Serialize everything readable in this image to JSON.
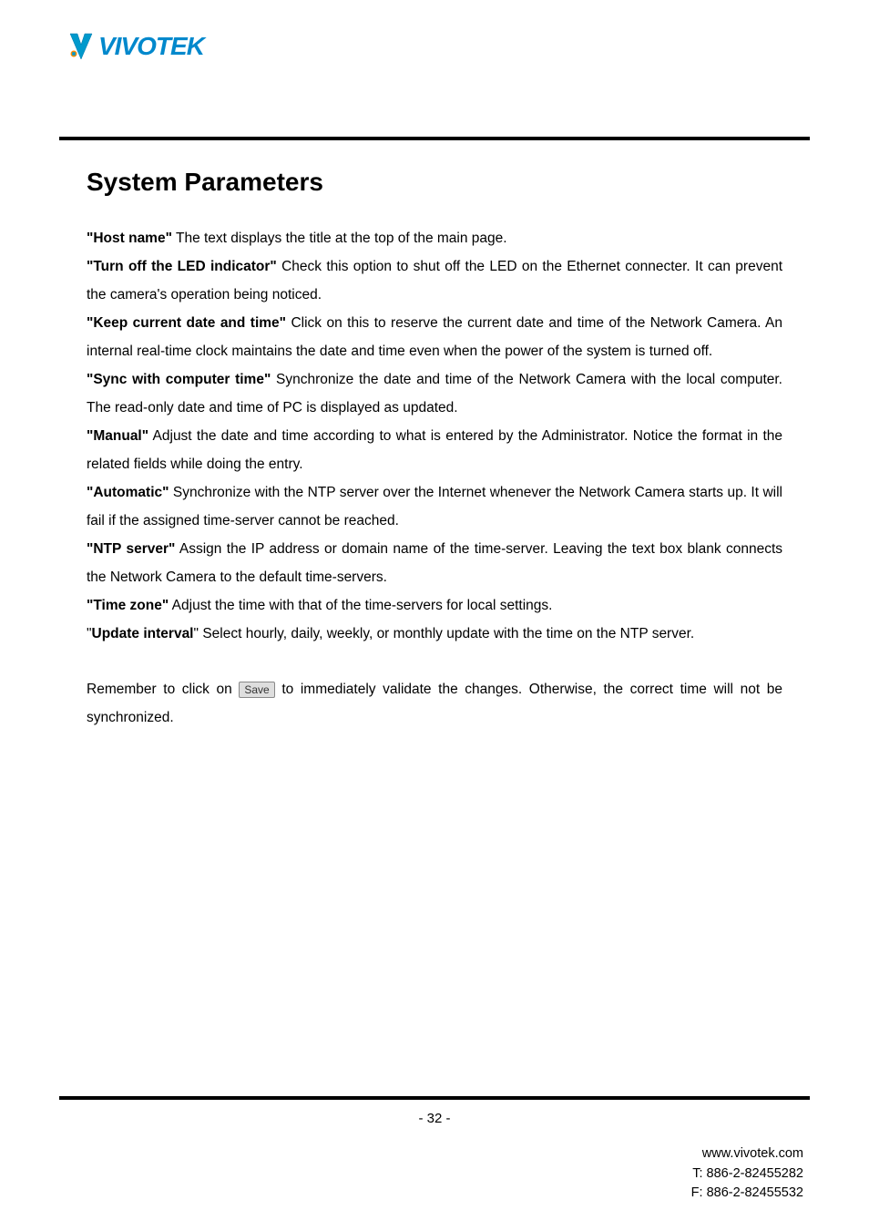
{
  "logo": {
    "brand_text": "VIVOTEK"
  },
  "heading": "System Parameters",
  "paragraphs": {
    "p1": {
      "label": "\"Host name\"",
      "text": " The text displays the title at the top of the main page."
    },
    "p2": {
      "label": "\"Turn off the LED indicator\"",
      "text": " Check this option to shut off the LED on the Ethernet connecter. It can prevent the camera's operation being noticed."
    },
    "p3": {
      "label": "\"Keep current date and time\"",
      "text": " Click on this to reserve the current date and time of the Network Camera. An internal real-time clock maintains the date and time even when the power of the system is turned off."
    },
    "p4": {
      "label": "\"Sync with computer time\"",
      "text": " Synchronize the date and time of the Network Camera with the local computer. The read-only date and time of PC is displayed as updated."
    },
    "p5": {
      "label": "\"Manual\"",
      "text": " Adjust the date and time according to what is entered by the Administrator. Notice the format in the related fields while doing the entry."
    },
    "p6": {
      "label": "\"Automatic\"",
      "text": " Synchronize with the NTP server over the Internet whenever the Network Camera starts up. It will fail if the assigned time-server cannot be reached."
    },
    "p7": {
      "label": "\"NTP server\"",
      "text": " Assign the IP address or domain name of the time-server. Leaving the text box blank connects the Network Camera to the default time-servers."
    },
    "p8": {
      "label": "\"Time zone\"",
      "text": " Adjust the time with that of the time-servers for local settings."
    },
    "p9": {
      "prefix": "\"",
      "label": "Update interval",
      "suffix": "\"",
      "text": " Select hourly, daily, weekly, or monthly update with the time on the NTP server."
    },
    "p10": {
      "text_before": "Remember to click on ",
      "button_label": "Save",
      "text_after": " to immediately validate the changes. Otherwise, the correct time will not be synchronized."
    }
  },
  "footer": {
    "page_number": "- 32 -",
    "website": "www.vivotek.com",
    "tel": "T: 886-2-82455282",
    "fax": "F: 886-2-82455532"
  }
}
